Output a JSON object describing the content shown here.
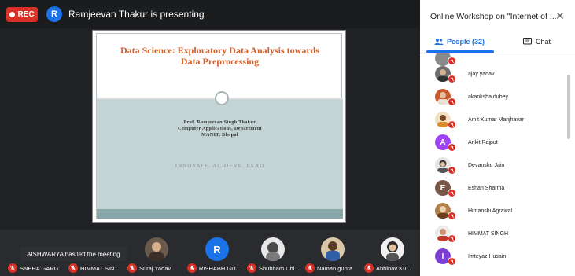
{
  "recording": {
    "label": "REC",
    "color": "#d93025"
  },
  "presenter": {
    "initial": "R",
    "text": "Ramjeevan Thakur is presenting"
  },
  "slide": {
    "title_line1": "Data Science:  Exploratory Data Analysis towards",
    "title_line2": "Data Preprocessing",
    "author_line1": "Prof. Ramjeevan Singh Thakur",
    "author_line2": "Computer Applications, Department",
    "author_line3": "MANIT, Bhopal",
    "tagline": "INNOVATE. ACHIEVE. LEAD"
  },
  "notification": {
    "text": "AISHWARYA has left the meeting"
  },
  "participants_strip": [
    {
      "name": "SNEHA GARG",
      "avatar": "none"
    },
    {
      "name": "HIMMAT SIN...",
      "avatar": "none"
    },
    {
      "name": "Suraj Yadav",
      "avatar": "photo"
    },
    {
      "name": "RISHABH GU...",
      "avatar": "letter",
      "initial": "R",
      "color": "#1a73e8"
    },
    {
      "name": "Shubham Chi...",
      "avatar": "photo"
    },
    {
      "name": "Naman gupta",
      "avatar": "photo"
    },
    {
      "name": "Abhinav Ku...",
      "avatar": "photo"
    }
  ],
  "panel": {
    "title": "Online Workshop on \"Internet of ...",
    "tab_people": "People (32)",
    "tab_chat": "Chat",
    "people": [
      {
        "name": "ajay yadav",
        "avatar": "photo",
        "color": "#6d6d6d"
      },
      {
        "name": "akanksha dubey",
        "avatar": "photo",
        "color": "#c9582c"
      },
      {
        "name": "Amit Kumar Manjhavar",
        "avatar": "photo",
        "color": "#d9a35a"
      },
      {
        "name": "Ankit Rajput",
        "avatar": "letter",
        "initial": "A",
        "color": "#a142f4"
      },
      {
        "name": "Devanshu Jain",
        "avatar": "photo",
        "color": "#5a5a5a"
      },
      {
        "name": "Eshan Sharma",
        "avatar": "letter",
        "initial": "E",
        "color": "#795548"
      },
      {
        "name": "Himanshi Agrawal",
        "avatar": "photo",
        "color": "#b07f4a"
      },
      {
        "name": "HIMMAT SINGH",
        "avatar": "photo",
        "color": "#c0392b"
      },
      {
        "name": "Imteyaz Husain",
        "avatar": "letter",
        "initial": "I",
        "color": "#7b3fd1"
      }
    ]
  }
}
